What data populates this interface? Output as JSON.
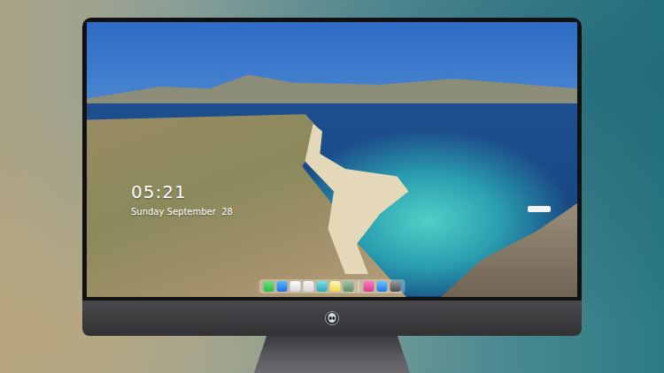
{
  "lock_screen": {
    "time": "05:21",
    "date": "Sunday September  28"
  }
}
